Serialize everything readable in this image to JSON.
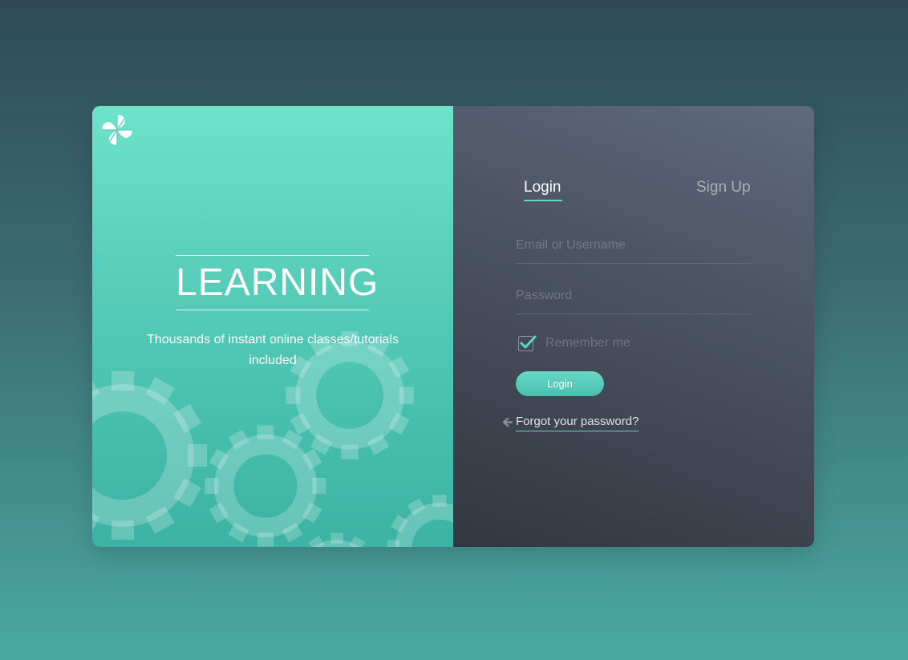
{
  "brand": {
    "title": "LEARNING",
    "tagline": "Thousands of instant online classes/tutorials included",
    "logo_icon": "clover-logo-icon",
    "decoration_icon": "gears-icon"
  },
  "tabs": [
    {
      "label": "Login",
      "active": true
    },
    {
      "label": "Sign Up",
      "active": false
    }
  ],
  "form": {
    "email": {
      "placeholder": "Email or Username",
      "value": ""
    },
    "password": {
      "placeholder": "Password",
      "value": ""
    },
    "remember": {
      "label": "Remember me",
      "checked": true
    },
    "submit_label": "Login",
    "forgot_label": "Forgot your password?",
    "forgot_icon": "arrow-left-icon"
  },
  "colors": {
    "accent": "#5fd6c0",
    "panel_left": "#52c8b6",
    "panel_right": "#4a5160"
  }
}
